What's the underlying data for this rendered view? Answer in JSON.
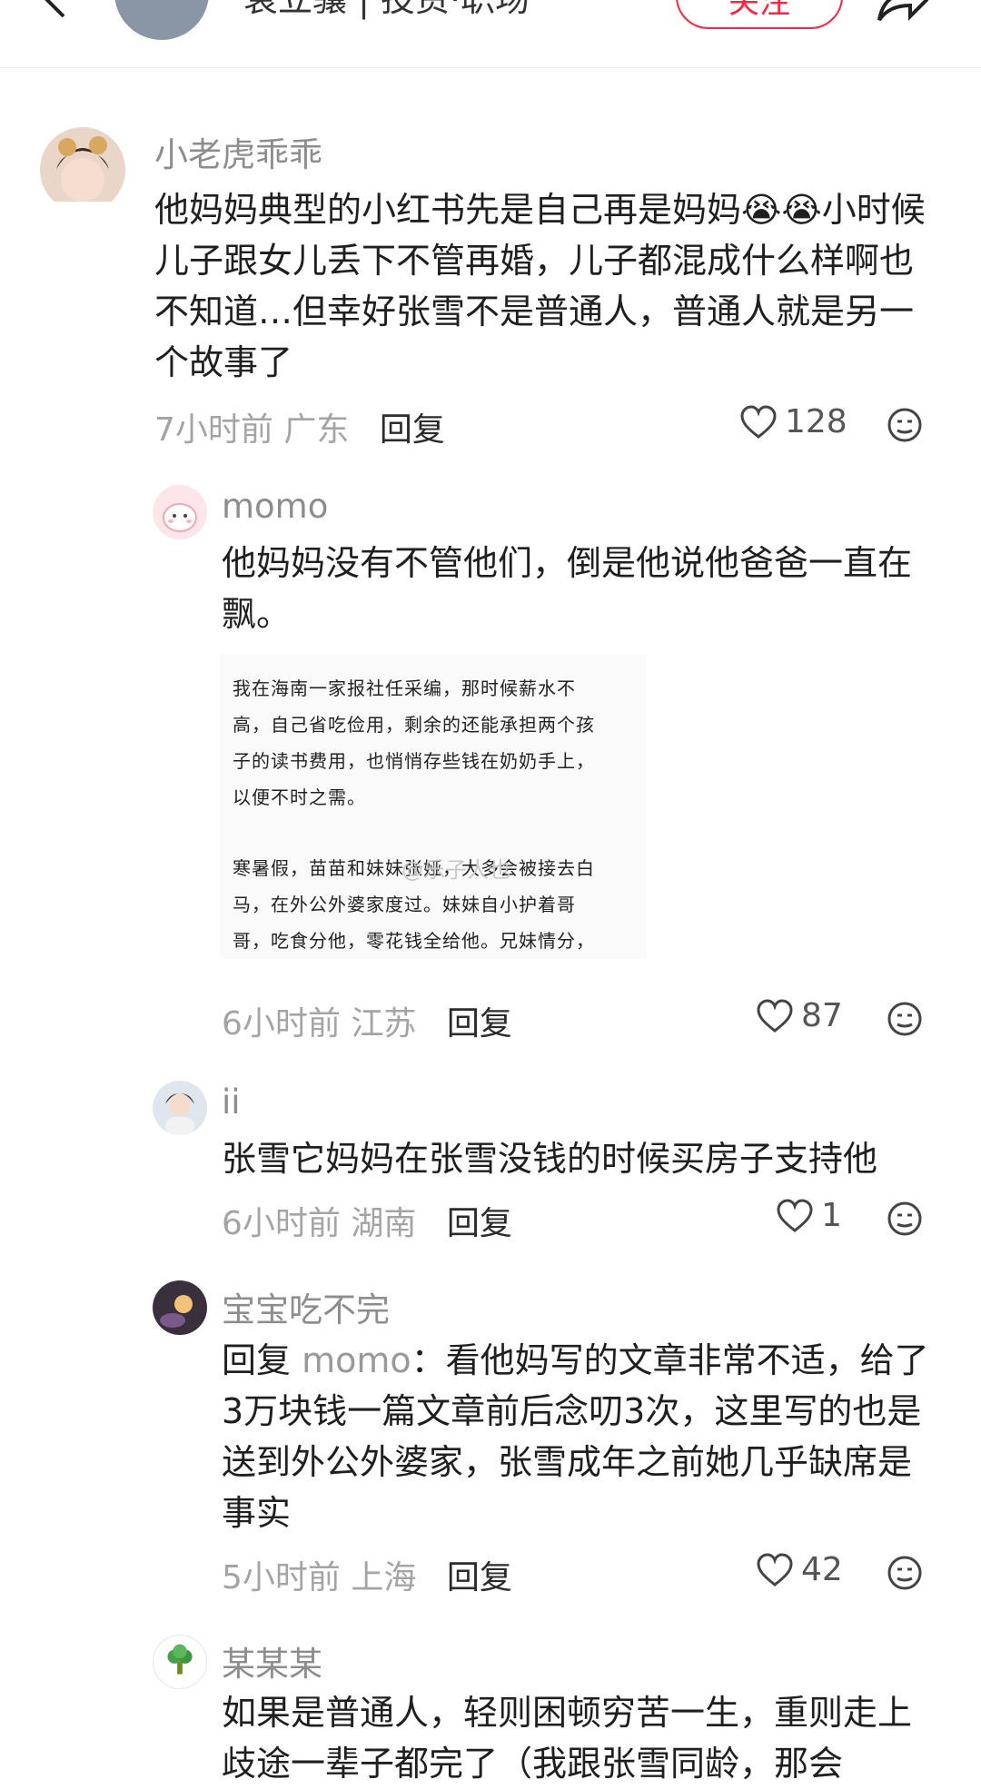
{
  "header": {
    "author_name": "袁立骧 | 投资·职场",
    "follow_label": "关注"
  },
  "comments": [
    {
      "username": "小老虎乖乖",
      "text": "他妈妈典型的小红书先是自己再是妈妈😭😭小时候儿子跟女儿丢下不管再婚，儿子都混成什么样啊也不知道…但幸好张雪不是普通人，普通人就是另一个故事了",
      "time": "7小时前",
      "location": "广东",
      "reply_label": "回复",
      "likes": "128"
    },
    {
      "username": "momo",
      "text": "他妈妈没有不管他们，倒是他说他爸爸一直在飘。",
      "image_text": {
        "line1": "我在海南一家报社任采编，那时候薪水不",
        "line2": "高，自己省吃俭用，剩余的还能承担两个孩",
        "line3": "子的读书费用，也悄悄存些钱在奶奶手上，",
        "line4": "以便不时之需。",
        "line5": "寒暑假，苗苗和妹妹张娅，大多会被接去白",
        "line6": "马，在外公外婆家度过。妹妹自小护着哥",
        "line7": "哥，吃食分他，零花钱全给他。兄妹情分，",
        "watermark": "@乐子人也"
      },
      "time": "6小时前",
      "location": "江苏",
      "reply_label": "回复",
      "likes": "87"
    },
    {
      "username": "ii",
      "text": "张雪它妈妈在张雪没钱的时候买房子支持他",
      "time": "6小时前",
      "location": "湖南",
      "reply_label": "回复",
      "likes": "1"
    },
    {
      "username": "宝宝吃不完",
      "reply_prefix": "回复",
      "reply_target": "momo",
      "text": "：看他妈写的文章非常不适，给了3万块钱一篇文章前后念叨3次，这里写的也是送到外公外婆家，张雪成年之前她几乎缺席是事实",
      "time": "5小时前",
      "location": "上海",
      "reply_label": "回复",
      "likes": "42"
    },
    {
      "username": "某某某",
      "text": "如果是普通人，轻则困顿穷苦一生，重则走上歧途一辈子都完了（我跟张雪同龄，那会"
    }
  ]
}
